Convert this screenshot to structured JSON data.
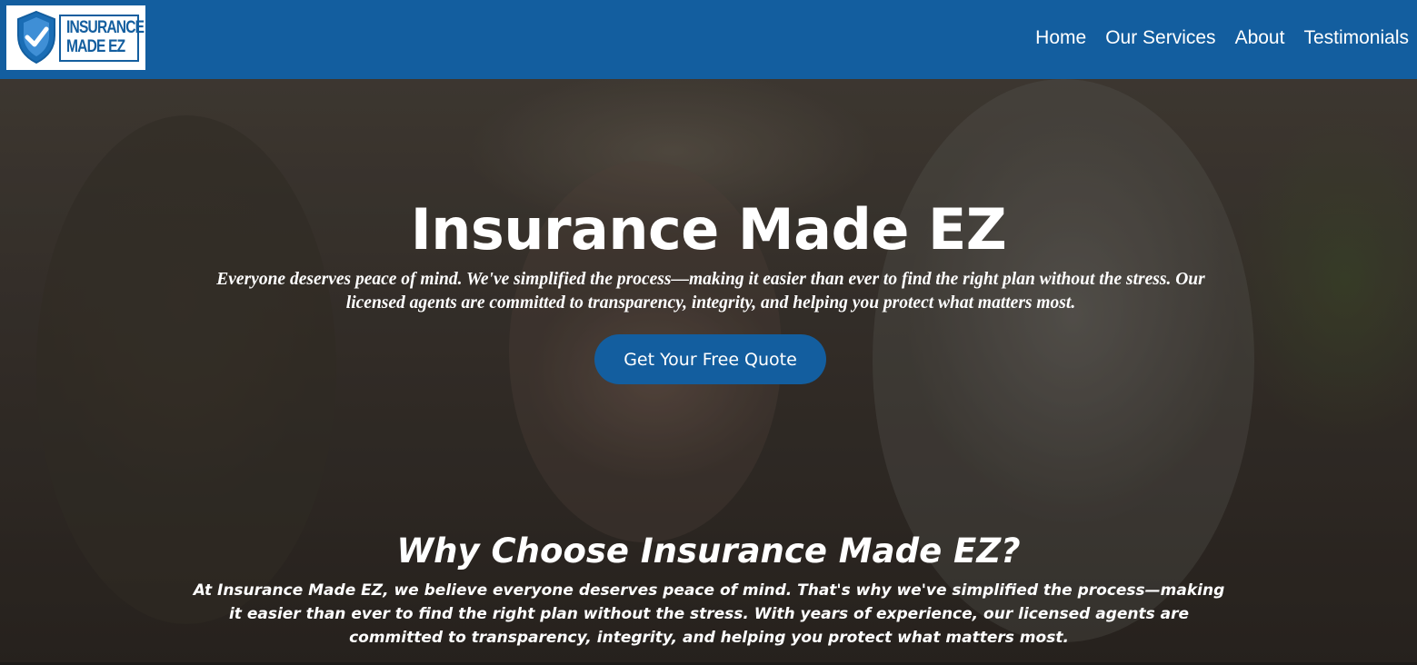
{
  "logo": {
    "line1": "INSURANCE",
    "line2": "MADE EZ",
    "icon": "shield-check-icon",
    "brand_color": "#135e9f"
  },
  "nav": {
    "items": [
      {
        "label": "Home"
      },
      {
        "label": "Our Services"
      },
      {
        "label": "About"
      },
      {
        "label": "Testimonials"
      }
    ]
  },
  "hero": {
    "title": "Insurance Made EZ",
    "description": "Everyone deserves peace of mind. We've simplified the process—making it easier than ever to find the right plan without the stress. Our licensed agents are committed to transparency, integrity, and helping you protect what matters most.",
    "cta_label": "Get Your Free Quote"
  },
  "why": {
    "title": "Why Choose Insurance Made EZ?",
    "description": "At Insurance Made EZ, we believe everyone deserves peace of mind. That's why we've simplified the process—making it easier than ever to find the right plan without the stress. With years of experience, our licensed agents are committed to transparency, integrity, and helping you protect what matters most."
  },
  "colors": {
    "navbar": "#135e9f",
    "button": "#135e9f",
    "text": "#ffffff"
  }
}
